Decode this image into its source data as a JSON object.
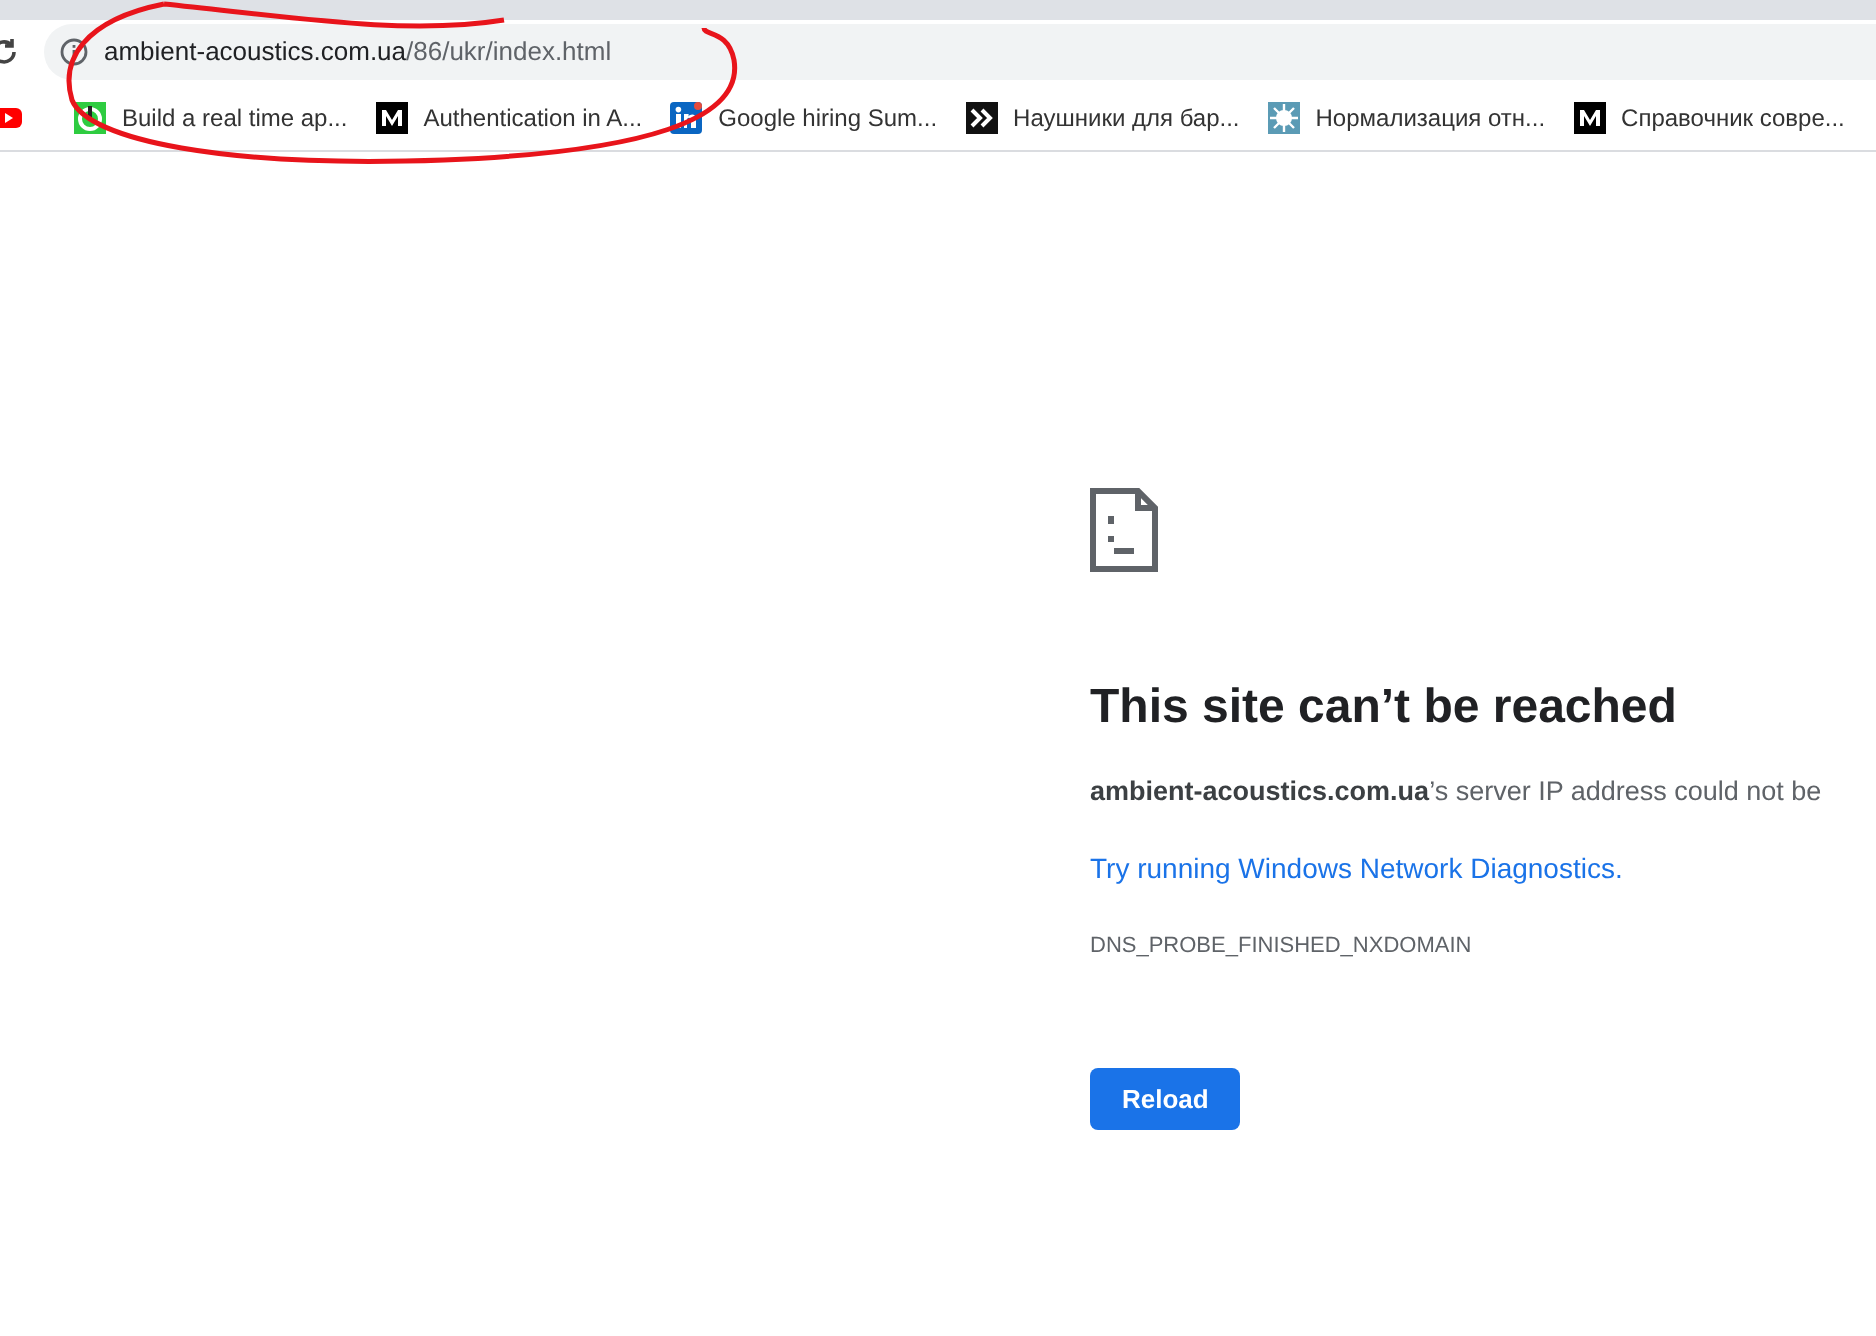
{
  "address_bar": {
    "host": "ambient-acoustics.com.ua",
    "path": "/86/ukr/index.html"
  },
  "bookmarks": [
    {
      "kind": "video"
    },
    {
      "kind": "power",
      "label": "Build a real time ap..."
    },
    {
      "kind": "medium",
      "label": "Authentication in A..."
    },
    {
      "kind": "linkedin",
      "label": "Google hiring Sum..."
    },
    {
      "kind": "chevrons",
      "label": "Наушники для бар..."
    },
    {
      "kind": "splash",
      "label": "Нормализация отн..."
    },
    {
      "kind": "medium",
      "label": "Справочник совре..."
    }
  ],
  "error": {
    "title": "This site can’t be reached",
    "message": "**ambient-acoustics.com.ua**’s server IP address could not be",
    "link": "Try running Windows Network Diagnostics.",
    "code": "DNS_PROBE_FINISHED_NXDOMAIN",
    "button": "Reload"
  }
}
